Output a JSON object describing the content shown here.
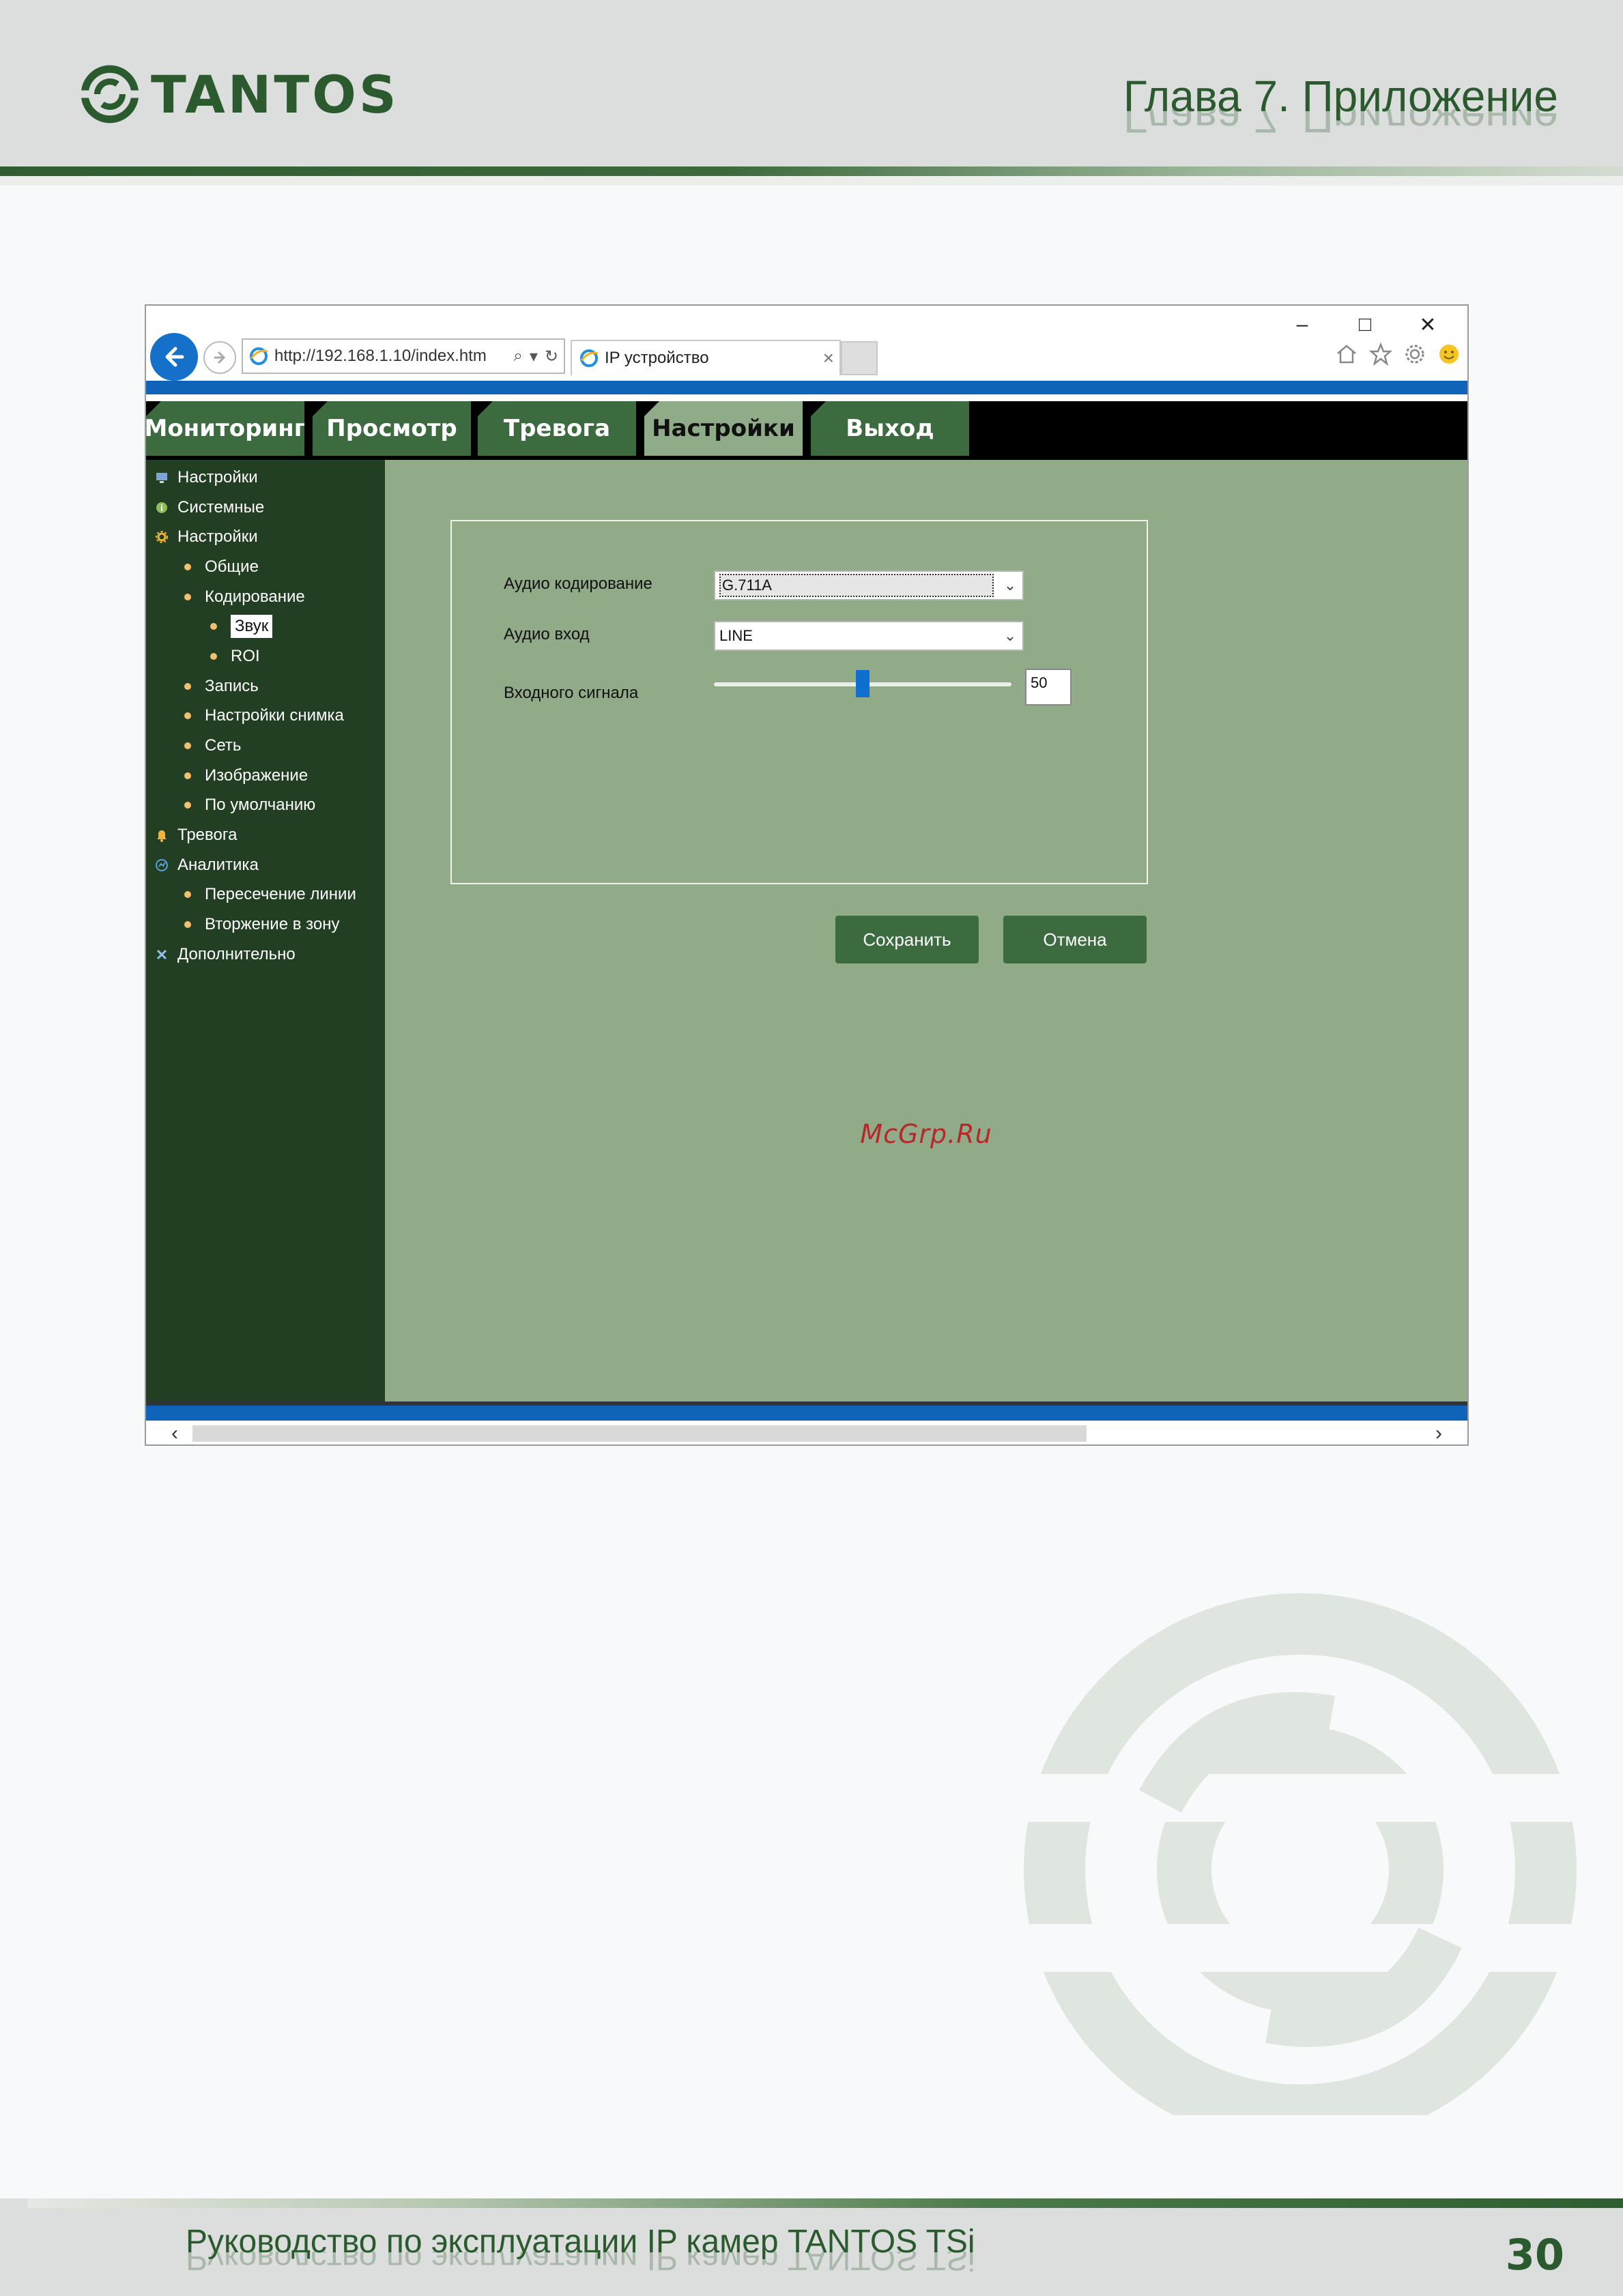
{
  "header": {
    "logo_text": "TANTOS",
    "chapter_title": "Глава 7. Приложение"
  },
  "browser": {
    "url": "http://192.168.1.10/index.htm",
    "tab_title": "IP устройство",
    "nav_tabs": [
      "Мониторинг",
      "Просмотр",
      "Тревога",
      "Настройки",
      "Выход"
    ],
    "active_tab": "Настройки"
  },
  "sidebar": {
    "items": [
      {
        "label": "Настройки",
        "level": 0,
        "icon": "monitor-icon"
      },
      {
        "label": "Системные",
        "level": 0,
        "icon": "info-icon"
      },
      {
        "label": "Настройки",
        "level": 0,
        "icon": "gear-icon"
      },
      {
        "label": "Общие",
        "level": 1
      },
      {
        "label": "Кодирование",
        "level": 1
      },
      {
        "label": "Звук",
        "level": 2,
        "selected": true
      },
      {
        "label": "ROI",
        "level": 2
      },
      {
        "label": "Запись",
        "level": 1
      },
      {
        "label": "Настройки снимка",
        "level": 1
      },
      {
        "label": "Сеть",
        "level": 1
      },
      {
        "label": "Изображение",
        "level": 1
      },
      {
        "label": "По умолчанию",
        "level": 1
      },
      {
        "label": "Тревога",
        "level": 0,
        "icon": "bell-icon"
      },
      {
        "label": "Аналитика",
        "level": 0,
        "icon": "analytics-icon"
      },
      {
        "label": "Пересечение линии",
        "level": 1
      },
      {
        "label": "Вторжение в зону",
        "level": 1
      },
      {
        "label": "Дополнительно",
        "level": 0,
        "icon": "tools-icon"
      }
    ]
  },
  "form": {
    "audio_codec_label": "Аудио кодирование",
    "audio_codec_value": "G.711A",
    "audio_input_label": "Аудио вход",
    "audio_input_value": "LINE",
    "input_signal_label": "Входного сигнала",
    "input_signal_value": "50",
    "input_signal_level": 0.5,
    "save_label": "Сохранить",
    "cancel_label": "Отмена"
  },
  "watermark": "McGrp.Ru",
  "footer": {
    "title": "Руководство по эксплуатации IP камер TANTOS TSi",
    "page_number": "30"
  },
  "colors": {
    "brand_green": "#2a5a2e",
    "nav_green": "#3b6b3f",
    "content_green": "#91aa87",
    "sidebar_green": "#223f23",
    "browser_blue": "#0f63b9"
  }
}
